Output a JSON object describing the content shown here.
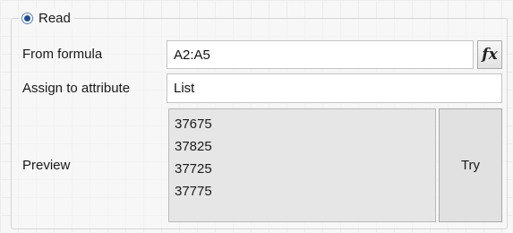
{
  "read_option": {
    "label": "Read",
    "selected": true
  },
  "from_formula": {
    "label": "From formula",
    "value": "A2:A5",
    "fx_icon": "fx-icon",
    "fx_glyph": "fx"
  },
  "assign_attribute": {
    "label": "Assign to attribute",
    "value": "List"
  },
  "preview": {
    "label": "Preview",
    "lines": [
      "37675",
      "37825",
      "37725",
      "37775"
    ]
  },
  "try_button": {
    "label": "Try"
  },
  "colors": {
    "radio_fill": "#1e4e94",
    "button_face": "#e1e1e1",
    "preview_background": "#e6e6e6"
  }
}
